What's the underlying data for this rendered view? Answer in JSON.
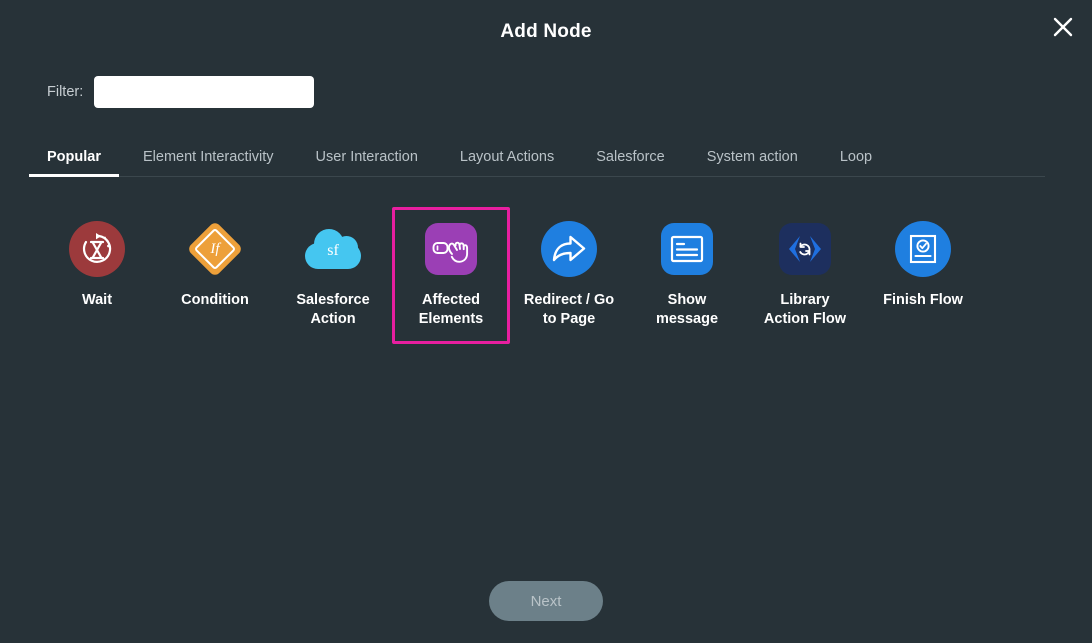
{
  "window": {
    "title": "Add Node",
    "background_color": "#273238",
    "close_icon": "close-icon"
  },
  "filter": {
    "label": "Filter:",
    "value": "",
    "placeholder": ""
  },
  "tabs": [
    {
      "label": "Popular",
      "active": true
    },
    {
      "label": "Element Interactivity",
      "active": false
    },
    {
      "label": "User Interaction",
      "active": false
    },
    {
      "label": "Layout Actions",
      "active": false
    },
    {
      "label": "Salesforce",
      "active": false
    },
    {
      "label": "System action",
      "active": false
    },
    {
      "label": "Loop",
      "active": false
    }
  ],
  "nodes": [
    {
      "label": "Wait",
      "icon": "hourglass-wait-icon",
      "icon_color": "#9c3a3c",
      "selected": false
    },
    {
      "label": "Condition",
      "icon": "if-diamond-icon",
      "icon_color": "#eda03a",
      "icon_text": "If",
      "selected": false
    },
    {
      "label": "Salesforce\nAction",
      "icon": "salesforce-cloud-icon",
      "icon_color": "#45c6f0",
      "icon_text": "sf",
      "selected": false
    },
    {
      "label": "Affected\nElements",
      "icon": "pointing-hand-icon",
      "icon_color": "#9b3fb5",
      "selected": true
    },
    {
      "label": "Redirect / Go\nto Page",
      "icon": "share-arrow-icon",
      "icon_color": "#1f7fe0",
      "selected": false
    },
    {
      "label": "Show\nmessage",
      "icon": "message-lines-icon",
      "icon_color": "#1f7fe0",
      "selected": false
    },
    {
      "label": "Library\nAction Flow",
      "icon": "code-brackets-refresh-icon",
      "icon_color": "#1d2f5e",
      "selected": false
    },
    {
      "label": "Finish Flow",
      "icon": "checked-document-icon",
      "icon_color": "#1f7fe0",
      "selected": false
    }
  ],
  "footer": {
    "next_label": "Next",
    "next_enabled": false
  },
  "colors": {
    "selection_border": "#e81fa0",
    "accent_text": "#ffffff",
    "muted_text": "#b9c2c7"
  }
}
